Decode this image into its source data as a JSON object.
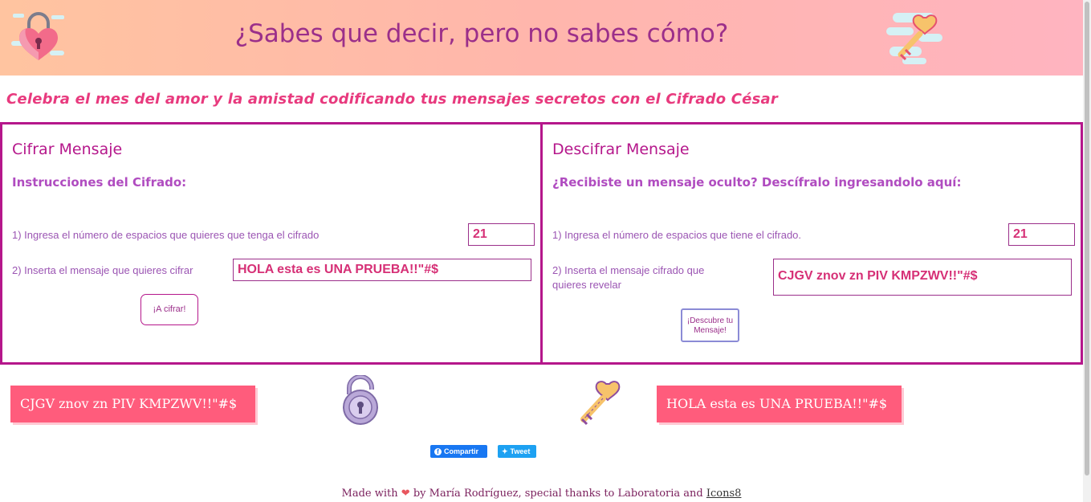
{
  "header": {
    "title": "¿Sabes que decir, pero no sabes cómo?",
    "left_icon": "heart-lock-icon",
    "right_icon": "key-icon"
  },
  "subtitle": "Celebra el mes del amor y la amistad codificando tus mensajes secretos con el Cifrado César",
  "cipher": {
    "title": "Cifrar Mensaje",
    "instructions_title": "Instrucciones del Cifrado:",
    "step1": "1) Ingresa el número de espacios que quieres que tenga el cifrado",
    "offset_value": "21",
    "step2": "2) Inserta el mensaje que quieres cifrar",
    "message_value": "HOLA esta es UNA PRUEBA!!\"#$",
    "button_label": "¡A cifrar!"
  },
  "decipher": {
    "title": "Descifrar Mensaje",
    "instructions_title": "¿Recibiste un mensaje oculto? Descífralo ingresandolo aquí:",
    "step1": "1) Ingresa el número de espacios que tiene el cifrado.",
    "offset_value": "21",
    "step2": "2) Inserta el mensaje cifrado que quieres revelar",
    "message_value": "CJGV znov zn PIV KMPZWV!!\"#$",
    "button_label": "¡Descubre tu Mensaje!"
  },
  "results": {
    "cipher_result": "CJGV znov zn PIV KMPZWV!!\"#$",
    "decipher_result": "HOLA esta es UNA PRUEBA!!\"#$",
    "cipher_icon": "open-padlock-icon",
    "decipher_icon": "heart-key-icon"
  },
  "share": {
    "facebook_label": "Compartir",
    "twitter_label": "Tweet"
  },
  "footer": {
    "made_with": "Made with",
    "by_text": "by María Rodríguez, special thanks to Laboratoria and",
    "link_text": "Icons8"
  },
  "colors": {
    "accent": "#b5178b",
    "result_bg": "#ff5c7c",
    "title": "#9b2f8a"
  }
}
